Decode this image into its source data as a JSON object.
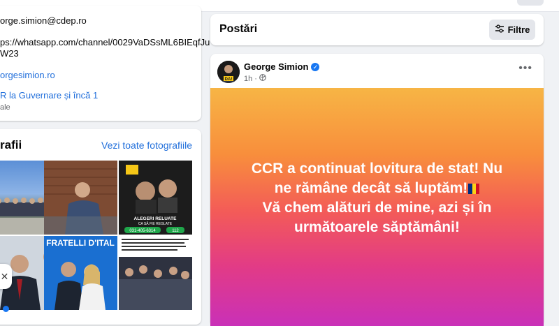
{
  "intro": {
    "email": "orge.simion@cdep.ro",
    "whatsapp_line1": "ps://whatsapp.com/channel/0029VaDSsML6BIEqfJu",
    "whatsapp_line2": "W23",
    "website": "orgesimion.ro",
    "group_link": "R la Guvernare și încă 1",
    "group_sub": "ale"
  },
  "photos": {
    "title": "rafii",
    "see_all": "Vezi toate fotografiile",
    "items": [
      {
        "desc": "group-outdoor"
      },
      {
        "desc": "man-brick-wall"
      },
      {
        "desc": "poster-alegeri"
      },
      {
        "desc": "men-portrait"
      },
      {
        "desc": "fratelli-italia"
      },
      {
        "desc": "document-crowd"
      }
    ],
    "poster_text": "ALEGERI RELUATE CA SĂ FIE REGLATE",
    "poster_phone_1": "031-405-6314",
    "poster_phone_2": "112",
    "poster_badge": "DAI!",
    "fratelli_text": "FRATELLI D'ITAL"
  },
  "posts_header": {
    "title": "Postări",
    "filter_label": "Filtre"
  },
  "post": {
    "author": "George Simion",
    "time": "1h",
    "avatar_badge": "DA!",
    "text_line1": "CCR a continuat lovitura de stat! Nu",
    "text_line2": "ne rămâne decât să luptăm!",
    "text_line3": "Vă chem alături de mine, azi și în",
    "text_line4": "următoarele săptămâni!"
  },
  "colors": {
    "link": "#216fdb",
    "accent": "#1877f2",
    "flag": [
      "#002b7f",
      "#fcd116",
      "#ce1126"
    ]
  }
}
